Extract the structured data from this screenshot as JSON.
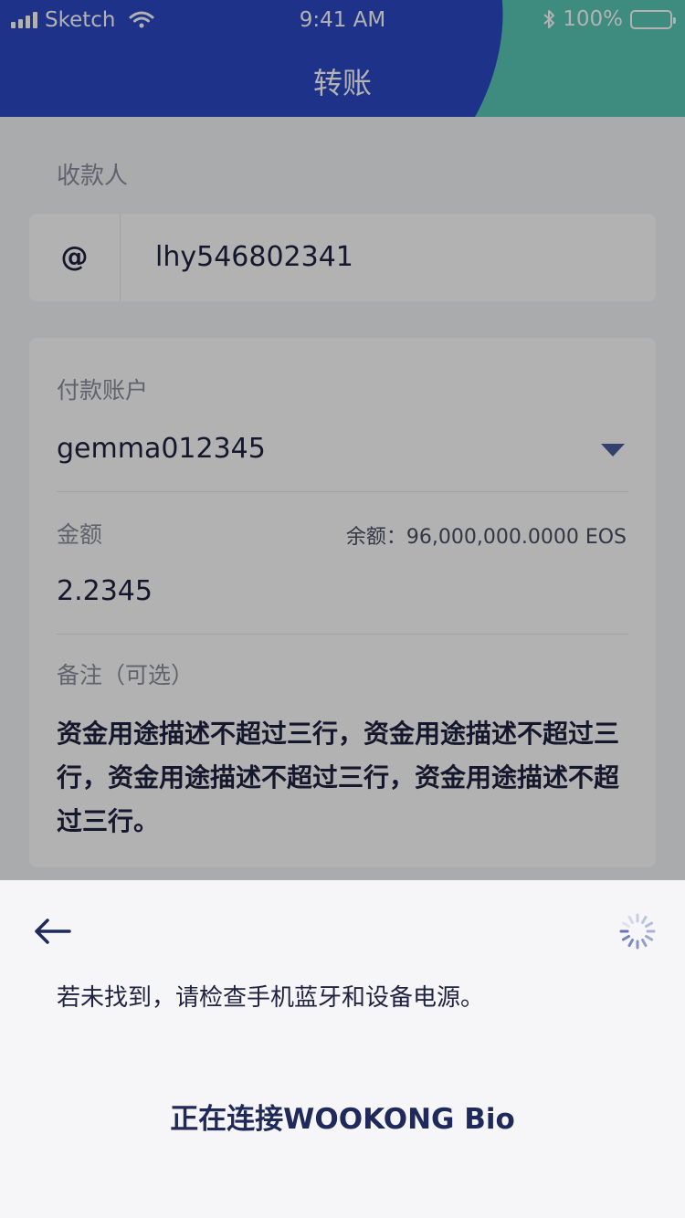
{
  "status_bar": {
    "carrier": "Sketch",
    "time": "9:41 AM",
    "battery": "100%"
  },
  "nav": {
    "title": "转账"
  },
  "recipient": {
    "label": "收款人",
    "prefix": "@",
    "value": "lhy546802341"
  },
  "payment": {
    "account_label": "付款账户",
    "account_value": "gemma012345",
    "amount_label": "金额",
    "balance": "余额：96,000,000.0000 EOS",
    "amount_value": "2.2345",
    "memo_label": "备注（可选）",
    "memo_value": "资金用途描述不超过三行，资金用途描述不超过三行，资金用途描述不超过三行，资金用途描述不超过三行。"
  },
  "sheet": {
    "hint": "若未找到，请检查手机蓝牙和设备电源。",
    "connecting": "正在连接WOOKONG Bio"
  },
  "icons": {
    "back": "back-arrow-icon",
    "spinner": "loading-spinner-icon",
    "dropdown": "caret-down-icon"
  },
  "colors": {
    "header_blue": "#2c48c6",
    "header_teal": "#59c7b6",
    "text_dark": "#1f2240"
  }
}
